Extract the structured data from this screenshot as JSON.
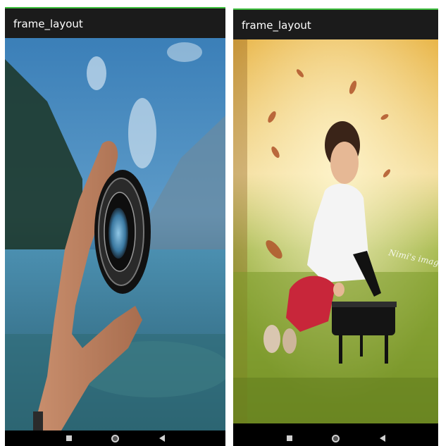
{
  "phones": [
    {
      "app_bar": {
        "title": "frame_layout"
      },
      "image": {
        "subject": "hand holding camera lens over mountain lake"
      },
      "nav": {
        "recents_icon": "square-icon",
        "home_icon": "circle-icon",
        "back_icon": "triangle-icon"
      }
    },
    {
      "app_bar": {
        "title": "frame_layout"
      },
      "image": {
        "subject": "child playing toy piano on grass",
        "watermark": "Nimi's images"
      },
      "nav": {
        "recents_icon": "square-icon",
        "home_icon": "circle-icon",
        "back_icon": "triangle-icon"
      }
    }
  ],
  "colors": {
    "status_strip": "#3fbf3f",
    "app_bar": "#1b1b1b",
    "nav_bar": "#000000"
  }
}
